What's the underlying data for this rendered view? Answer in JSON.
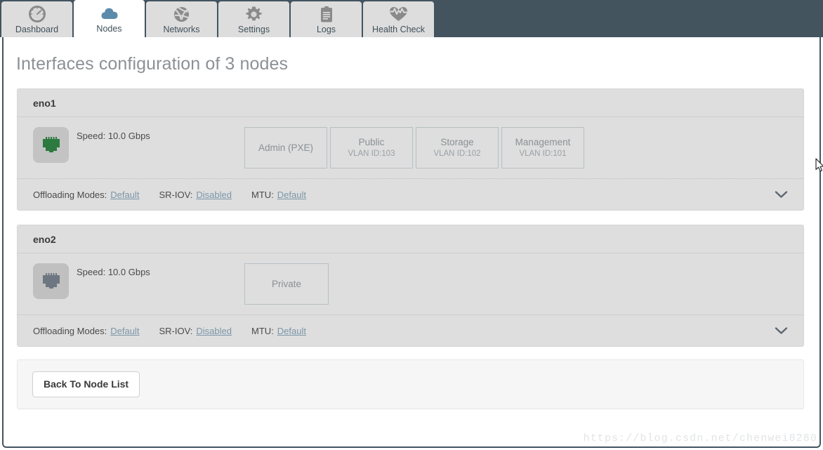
{
  "navbar": {
    "tabs": [
      {
        "label": "Dashboard",
        "icon": "speedometer-icon",
        "active": false
      },
      {
        "label": "Nodes",
        "icon": "cloud-icon",
        "active": true
      },
      {
        "label": "Networks",
        "icon": "globe-icon",
        "active": false
      },
      {
        "label": "Settings",
        "icon": "gear-icon",
        "active": false
      },
      {
        "label": "Logs",
        "icon": "clipboard-icon",
        "active": false
      },
      {
        "label": "Health Check",
        "icon": "heartbeat-icon",
        "active": false
      }
    ]
  },
  "page": {
    "title": "Interfaces configuration of 3 nodes"
  },
  "interfaces": [
    {
      "name": "eno1",
      "link_state": "up",
      "port_icon": "ethernet-port-icon",
      "speed": "Speed: 10.0 Gbps",
      "networks": [
        {
          "name": "Admin (PXE)",
          "vlan": ""
        },
        {
          "name": "Public",
          "vlan": "VLAN ID:103"
        },
        {
          "name": "Storage",
          "vlan": "VLAN ID:102"
        },
        {
          "name": "Management",
          "vlan": "VLAN ID:101"
        }
      ],
      "footer": {
        "offloading_label": "Offloading Modes:",
        "offloading_value": "Default",
        "sriov_label": "SR-IOV:",
        "sriov_value": "Disabled",
        "mtu_label": "MTU:",
        "mtu_value": "Default",
        "expand_icon": "chevron-down-icon"
      }
    },
    {
      "name": "eno2",
      "link_state": "down",
      "port_icon": "ethernet-port-icon",
      "speed": "Speed: 10.0 Gbps",
      "networks": [
        {
          "name": "Private",
          "vlan": ""
        }
      ],
      "footer": {
        "offloading_label": "Offloading Modes:",
        "offloading_value": "Default",
        "sriov_label": "SR-IOV:",
        "sriov_value": "Disabled",
        "mtu_label": "MTU:",
        "mtu_value": "Default",
        "expand_icon": "chevron-down-icon"
      }
    }
  ],
  "actions": {
    "back_label": "Back To Node List"
  },
  "watermark": {
    "text": "https://blog.csdn.net/chenwei8280"
  },
  "colors": {
    "navbar_bg": "#43545f",
    "tab_inactive_bg": "#dddddd",
    "tab_active_bg": "#ffffff",
    "panel_bg": "#dedede",
    "link": "#7b96a8",
    "port_up": "#2c7a3f",
    "port_down": "#6e7682",
    "title_text": "#8c9196"
  }
}
